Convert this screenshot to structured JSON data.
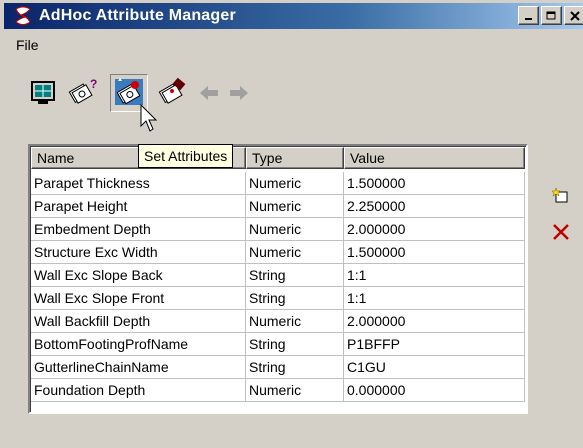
{
  "window": {
    "title": "AdHoc Attribute Manager",
    "buttons": [
      "_",
      "□",
      "×"
    ]
  },
  "menu": {
    "items": [
      "File"
    ]
  },
  "toolbar": {
    "buttons": [
      {
        "name": "view-icon"
      },
      {
        "name": "query-attributes-icon"
      },
      {
        "name": "set-attributes-icon",
        "pressed": true
      },
      {
        "name": "clear-attributes-icon"
      },
      {
        "name": "back-arrow-icon",
        "enabled": false
      },
      {
        "name": "forward-arrow-icon",
        "enabled": false
      }
    ],
    "tooltip": "Set Attributes"
  },
  "table": {
    "columns": [
      "Name",
      "Type",
      "Value"
    ],
    "rows": [
      {
        "name": "Parapet Thickness",
        "type": "Numeric",
        "value": "1.500000"
      },
      {
        "name": "Parapet Height",
        "type": "Numeric",
        "value": "2.250000"
      },
      {
        "name": "Embedment Depth",
        "type": "Numeric",
        "value": "2.000000"
      },
      {
        "name": "Structure Exc Width",
        "type": "Numeric",
        "value": "1.500000"
      },
      {
        "name": "Wall Exc Slope Back",
        "type": "String",
        "value": "1:1"
      },
      {
        "name": "Wall Exc Slope Front",
        "type": "String",
        "value": "1:1"
      },
      {
        "name": "Wall Backfill Depth",
        "type": "Numeric",
        "value": "2.000000"
      },
      {
        "name": "BottomFootingProfName",
        "type": "String",
        "value": "P1BFFP"
      },
      {
        "name": "GutterlineChainName",
        "type": "String",
        "value": "C1GU"
      },
      {
        "name": "Foundation Depth",
        "type": "Numeric",
        "value": "0.000000"
      }
    ]
  },
  "side_actions": [
    {
      "name": "new-attribute-icon"
    },
    {
      "name": "delete-attribute-icon",
      "color": "#c00000"
    }
  ],
  "colors": {
    "titlebar_start": "#0a246a",
    "titlebar_end": "#a6caf0",
    "tooltip_bg": "#ffffe1"
  }
}
